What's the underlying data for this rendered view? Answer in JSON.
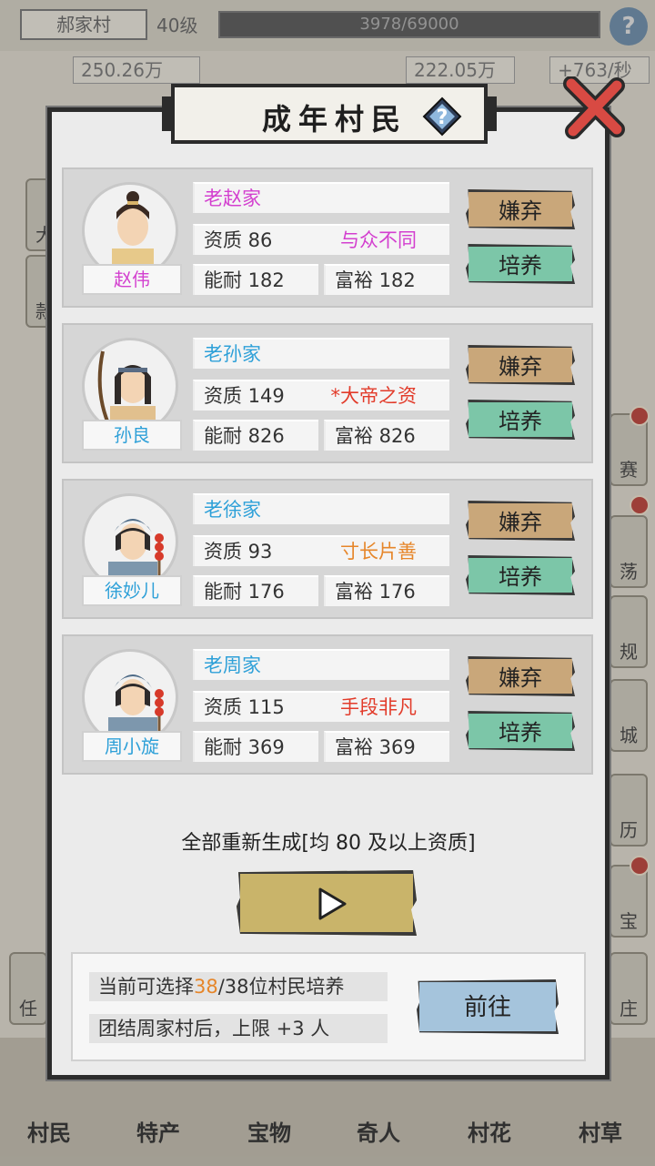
{
  "header": {
    "village_name": "郝家村",
    "level": "40级",
    "exp": "3978/69000",
    "stat1": "250.26万",
    "stat2": "222.05万",
    "rate": "+763/秒"
  },
  "side_labels": [
    "大",
    "款",
    "赛",
    "荡",
    "规",
    "城",
    "历",
    "宝",
    "庄",
    "任"
  ],
  "bottom_tabs": [
    "村民",
    "特产",
    "宝物",
    "奇人",
    "村花",
    "村草"
  ],
  "modal": {
    "title": "成年村民",
    "help_glyph": "?",
    "abandon_label": "嫌弃",
    "train_label": "培养",
    "villagers": [
      {
        "family": "老赵家",
        "name": "赵伟",
        "name_color": "#d33fcf",
        "quality": "资质 86",
        "trait": "与众不同",
        "trait_color": "#d33fcf",
        "ability": "能耐 182",
        "wealth": "富裕 182"
      },
      {
        "family": "老孙家",
        "name": "孙良",
        "name_color": "#2ea0d8",
        "quality": "资质 149",
        "trait": "*大帝之资",
        "trait_color": "#e23b2a",
        "ability": "能耐 826",
        "wealth": "富裕 826"
      },
      {
        "family": "老徐家",
        "name": "徐妙儿",
        "name_color": "#2ea0d8",
        "quality": "资质 93",
        "trait": "寸长片善",
        "trait_color": "#e6862a",
        "ability": "能耐 176",
        "wealth": "富裕 176"
      },
      {
        "family": "老周家",
        "name": "周小旋",
        "name_color": "#2ea0d8",
        "quality": "资质 115",
        "trait": "手段非凡",
        "trait_color": "#e23b2a",
        "ability": "能耐 369",
        "wealth": "富裕 369"
      }
    ],
    "regen_label": "全部重新生成[均 80 及以上资质]",
    "info": {
      "line1_prefix": "当前可选择",
      "line1_count": "38",
      "line1_suffix": "/38位村民培养",
      "line2": "团结周家村后，上限 +3 人",
      "go_label": "前往"
    }
  }
}
